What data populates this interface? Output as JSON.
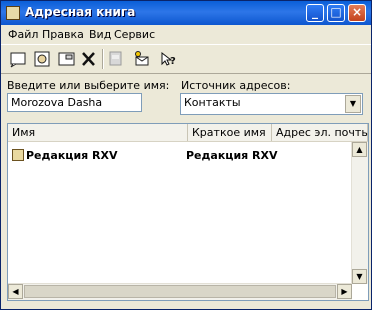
{
  "window": {
    "title": "Адресная книга"
  },
  "menu": {
    "items": [
      "Файл",
      "Правка",
      "Вид",
      "Сервис"
    ]
  },
  "toolbar": {
    "icons": [
      "new-card-icon",
      "properties-icon",
      "open-icon",
      "delete-icon",
      "print-icon",
      "send-mail-icon",
      "help-icon"
    ]
  },
  "form": {
    "name_label": "Введите или выберите имя:",
    "name_value": "Morozova Dasha",
    "source_label": "Источник адресов:",
    "source_value": "Контакты"
  },
  "table": {
    "headers": [
      "Имя",
      "Краткое имя",
      "Адрес эл. почты"
    ],
    "rows": [
      {
        "name": "Редакция RXV",
        "short": "Редакция RXV",
        "email": ""
      }
    ]
  }
}
